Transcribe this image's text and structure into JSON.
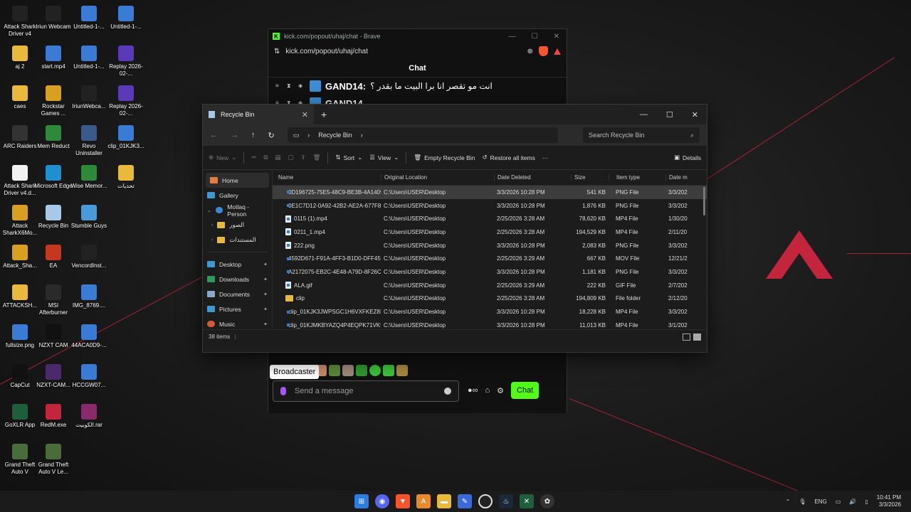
{
  "desktop": {
    "icons": [
      {
        "label": "Attack Shark Driver v4",
        "icon": "attack-shark-icon",
        "color": "#222"
      },
      {
        "label": "aj 2",
        "icon": "folder-icon",
        "color": "#e8b93a"
      },
      {
        "label": "caes",
        "icon": "folder-icon",
        "color": "#e8b93a"
      },
      {
        "label": "ARC Raiders",
        "icon": "arc-raiders-icon",
        "color": "#333"
      },
      {
        "label": "Attack Shark Driver v4.d...",
        "icon": "document-icon",
        "color": "#f2f2f2"
      },
      {
        "label": "Attack SharkX6Mo...",
        "icon": "attack-shark-icon",
        "color": "#d8a020"
      },
      {
        "label": "Attack_Sha...",
        "icon": "attack-shark-icon",
        "color": "#d8a020"
      },
      {
        "label": "ATTACKSH...",
        "icon": "folder-icon",
        "color": "#e8b93a"
      },
      {
        "label": "fullsize.png",
        "icon": "image-icon",
        "color": "#3a7bd5"
      },
      {
        "label": "CapCut",
        "icon": "capcut-icon",
        "color": "#111"
      },
      {
        "label": "GoXLR App",
        "icon": "goxlr-icon",
        "color": "#1f5e3a"
      },
      {
        "label": "Grand Theft Auto V",
        "icon": "gta-icon",
        "color": "#4a6b3a"
      },
      {
        "label": "Iriun Webcam",
        "icon": "iriun-icon",
        "color": "#222"
      },
      {
        "label": "start.mp4",
        "icon": "video-icon",
        "color": "#3a7bd5"
      },
      {
        "label": "Rockstar Games ...",
        "icon": "rockstar-icon",
        "color": "#d8a020"
      },
      {
        "label": "Mem Reduct",
        "icon": "memreduct-icon",
        "color": "#2d8a3a"
      },
      {
        "label": "Microsoft Edge",
        "icon": "edge-icon",
        "color": "#1f8fcf"
      },
      {
        "label": "Recycle Bin",
        "icon": "recycle-bin-icon",
        "color": "#a8c8e8"
      },
      {
        "label": "EA",
        "icon": "ea-icon",
        "color": "#c3381e"
      },
      {
        "label": "MSI Afterburner",
        "icon": "msi-icon",
        "color": "#2a2a2a"
      },
      {
        "label": "NZXT CAM",
        "icon": "nzxt-icon",
        "color": "#111"
      },
      {
        "label": "NZXT-CAM...",
        "icon": "nzxt-icon",
        "color": "#4a2a6a"
      },
      {
        "label": "RedM.exe",
        "icon": "redm-icon",
        "color": "#c3253d"
      },
      {
        "label": "Grand Theft Auto V Le...",
        "icon": "gta-icon",
        "color": "#4a6b3a"
      },
      {
        "label": "Untitled-1-...",
        "icon": "image-icon",
        "color": "#3a7bd5"
      },
      {
        "label": "Untitled-1-...",
        "icon": "image-icon",
        "color": "#3a7bd5"
      },
      {
        "label": "IriunWebca...",
        "icon": "iriun-icon",
        "color": "#222"
      },
      {
        "label": "Revo Uninstaller",
        "icon": "revo-icon",
        "color": "#3a5a8a"
      },
      {
        "label": "Wise Memor...",
        "icon": "wise-icon",
        "color": "#2d8a3a"
      },
      {
        "label": "Stumble Guys",
        "icon": "stumble-icon",
        "color": "#4a9ad8"
      },
      {
        "label": "VencordInst...",
        "icon": "vencord-icon",
        "color": "#222"
      },
      {
        "label": "IMG_8769....",
        "icon": "image-icon",
        "color": "#3a7bd5"
      },
      {
        "label": "44ACA0D9-...",
        "icon": "image-icon",
        "color": "#3a7bd5"
      },
      {
        "label": "HCCGW07...",
        "icon": "image-icon",
        "color": "#3a7bd5"
      },
      {
        "label": "الكوبيت.rar",
        "icon": "rar-icon",
        "color": "#8a2a6a"
      },
      {
        "label": "Untitled-1-...",
        "icon": "image-icon",
        "color": "#3a7bd5"
      },
      {
        "label": "Replay 2026-02-...",
        "icon": "replay-icon",
        "color": "#5a3ab8"
      },
      {
        "label": "Replay 2026-02-...",
        "icon": "replay-icon",
        "color": "#5a3ab8"
      },
      {
        "label": "clip_01KJK3...",
        "icon": "video-icon",
        "color": "#3a7bd5"
      },
      {
        "label": "تحديات",
        "icon": "folder-icon",
        "color": "#e8b93a"
      }
    ]
  },
  "brave": {
    "tab_title": "kick.com/popout/uhaj/chat - Brave",
    "url": "kick.com/popout/uhaj/chat",
    "chat_header": "Chat",
    "messages": [
      {
        "user": "GAND14:",
        "text": "انت مو تقصر انا برا البيت ما بقدر ؟"
      },
      {
        "user": "GAND14",
        "text": ""
      }
    ],
    "tooltip": "Broadcaster",
    "input_placeholder": "Send a message",
    "chat_button": "Chat"
  },
  "explorer": {
    "tab_title": "Recycle Bin",
    "breadcrumb": "Recycle Bin",
    "search_placeholder": "Search Recycle Bin",
    "commands": {
      "new": "New",
      "sort": "Sort",
      "view": "View",
      "empty": "Empty Recycle Bin",
      "restore": "Restore all items",
      "more": "···",
      "details": "Details"
    },
    "nav": [
      {
        "label": "Home",
        "icon": "home-icon"
      },
      {
        "label": "Gallery",
        "icon": "gallery-icon"
      },
      {
        "label": "Motlaq - Person",
        "icon": "onedrive-icon"
      },
      {
        "label": "الصور",
        "icon": "folder-icon"
      },
      {
        "label": "المستندات",
        "icon": "folder-icon"
      },
      {
        "label": "Desktop",
        "icon": "desktop-icon"
      },
      {
        "label": "Downloads",
        "icon": "downloads-icon"
      },
      {
        "label": "Documents",
        "icon": "documents-icon"
      },
      {
        "label": "Pictures",
        "icon": "pictures-icon"
      },
      {
        "label": "Music",
        "icon": "music-icon"
      }
    ],
    "columns": {
      "name": "Name",
      "location": "Original Location",
      "deleted": "Date Deleted",
      "size": "Size",
      "type": "Item type",
      "modified": "Date m"
    },
    "files": [
      {
        "name": "0D196725-75E5-48C9-BE3B-4A1409...",
        "location": "C:\\Users\\USER\\Desktop",
        "deleted": "3/3/2026 10:28 PM",
        "size": "541 KB",
        "type": "PNG File",
        "modified": "3/3/202"
      },
      {
        "name": "0E1C7D12-0A92-42B2-AE2A-677F8...",
        "location": "C:\\Users\\USER\\Desktop",
        "deleted": "3/3/2026 10:28 PM",
        "size": "1,876 KB",
        "type": "PNG File",
        "modified": "3/3/202"
      },
      {
        "name": "0115 (1).mp4",
        "location": "C:\\Users\\USER\\Desktop",
        "deleted": "2/25/2026 3:28 AM",
        "size": "78,620 KB",
        "type": "MP4 File",
        "modified": "1/30/20"
      },
      {
        "name": "0211_1.mp4",
        "location": "C:\\Users\\USER\\Desktop",
        "deleted": "2/25/2026 3:28 AM",
        "size": "194,529 KB",
        "type": "MP4 File",
        "modified": "2/11/20"
      },
      {
        "name": "222.png",
        "location": "C:\\Users\\USER\\Desktop",
        "deleted": "3/3/2026 10:28 PM",
        "size": "2,083 KB",
        "type": "PNG File",
        "modified": "3/3/202"
      },
      {
        "name": "4592D671-F91A-4FF3-B1D0-DFF453...",
        "location": "C:\\Users\\USER\\Desktop",
        "deleted": "2/25/2026 3:29 AM",
        "size": "667 KB",
        "type": "MOV File",
        "modified": "12/21/2"
      },
      {
        "name": "A2172075-EB2C-4E48-A79D-8F26C...",
        "location": "C:\\Users\\USER\\Desktop",
        "deleted": "3/3/2026 10:28 PM",
        "size": "1,181 KB",
        "type": "PNG File",
        "modified": "3/3/202"
      },
      {
        "name": "ALA.gif",
        "location": "C:\\Users\\USER\\Desktop",
        "deleted": "2/25/2026 3:29 AM",
        "size": "222 KB",
        "type": "GIF File",
        "modified": "2/7/202"
      },
      {
        "name": "clip",
        "location": "C:\\Users\\USER\\Desktop",
        "deleted": "2/25/2026 3:28 AM",
        "size": "194,809 KB",
        "type": "File folder",
        "modified": "2/12/20"
      },
      {
        "name": "clip_01KJK3JWPSGC1H6VXFKEZ8P...",
        "location": "C:\\Users\\USER\\Desktop",
        "deleted": "3/3/2026 10:28 PM",
        "size": "18,228 KB",
        "type": "MP4 File",
        "modified": "3/3/202"
      },
      {
        "name": "clip_01KJMKBYAZQ4P4EQPK71VK9...",
        "location": "C:\\Users\\USER\\Desktop",
        "deleted": "3/3/2026 10:28 PM",
        "size": "11,013 KB",
        "type": "MP4 File",
        "modified": "3/1/202"
      }
    ],
    "status": "38 items"
  },
  "taskbar": {
    "lang": "ENG",
    "time": "10:41 PM",
    "date": "3/3/2026"
  },
  "colors": {
    "accent_red": "#c3253d",
    "kick_green": "#53fc18"
  }
}
